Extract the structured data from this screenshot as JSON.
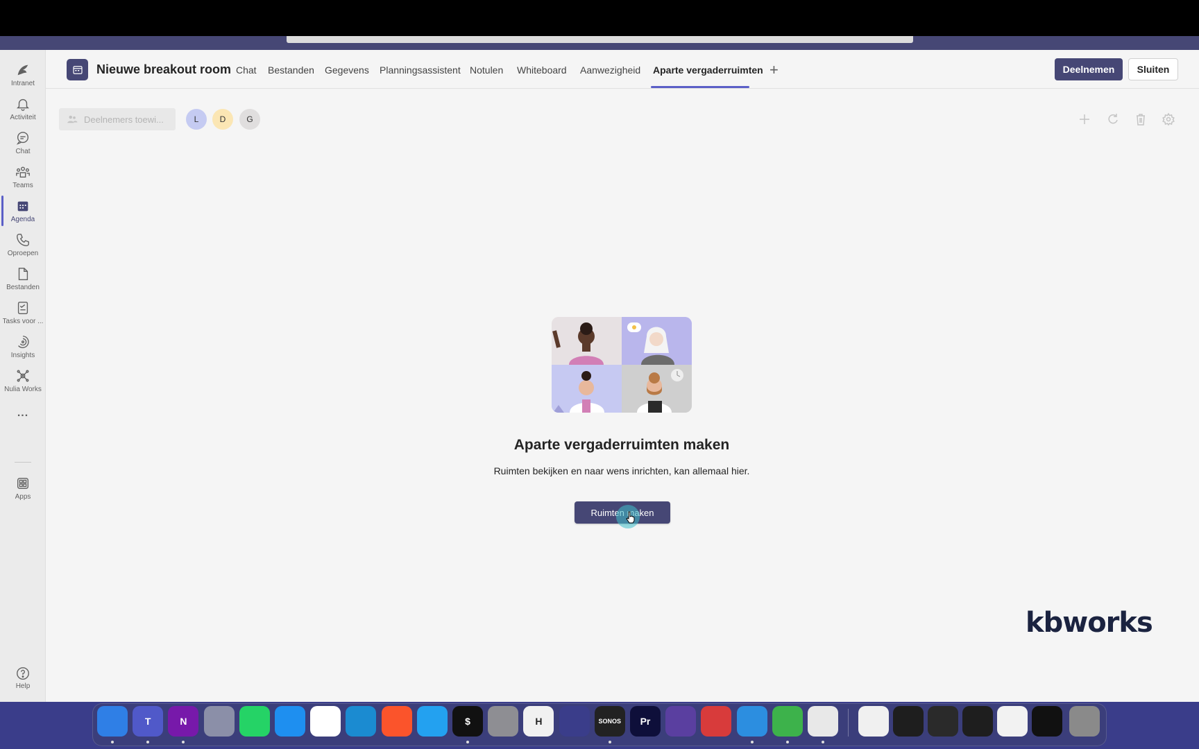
{
  "meeting": {
    "title": "Nieuwe breakout room"
  },
  "tabs": [
    "Chat",
    "Bestanden",
    "Gegevens",
    "Planningsassistent",
    "Notulen",
    "Whiteboard",
    "Aanwezigheid",
    "Aparte vergaderruimten"
  ],
  "active_tab": "Aparte vergaderruimten",
  "header_buttons": {
    "join": "Deelnemen",
    "close": "Sluiten"
  },
  "rail": [
    {
      "label": "Intranet",
      "icon": "intranet-icon"
    },
    {
      "label": "Activiteit",
      "icon": "bell-icon"
    },
    {
      "label": "Chat",
      "icon": "chat-icon"
    },
    {
      "label": "Teams",
      "icon": "teams-icon"
    },
    {
      "label": "Agenda",
      "icon": "calendar-icon",
      "active": true
    },
    {
      "label": "Oproepen",
      "icon": "phone-icon"
    },
    {
      "label": "Bestanden",
      "icon": "file-icon"
    },
    {
      "label": "Tasks voor ...",
      "icon": "tasks-icon"
    },
    {
      "label": "Insights",
      "icon": "insights-icon"
    },
    {
      "label": "Nulia Works",
      "icon": "nulia-icon"
    },
    {
      "label": "...",
      "icon": "more-icon"
    },
    {
      "label": "Apps",
      "icon": "apps-icon"
    }
  ],
  "help_label": "Help",
  "toolbar": {
    "assign_label": "Deelnemers toewi...",
    "participants": [
      {
        "initial": "L",
        "color": "#c5cbf2"
      },
      {
        "initial": "D",
        "color": "#fbe6b4"
      },
      {
        "initial": "G",
        "color": "#e0dede"
      }
    ]
  },
  "empty_state": {
    "title": "Aparte vergaderruimten maken",
    "subtitle": "Ruimten bekijken en naar wens inrichten, kan allemaal hier.",
    "button": "Ruimten maken"
  },
  "brand": "kbworks",
  "dock": [
    {
      "name": "finder",
      "bg": "#2f7fe6",
      "text": ""
    },
    {
      "name": "teams",
      "bg": "#5059c9",
      "text": "T"
    },
    {
      "name": "onenote",
      "bg": "#7719aa",
      "text": "N"
    },
    {
      "name": "launchpad",
      "bg": "#8b8fa8",
      "text": ""
    },
    {
      "name": "whatsapp",
      "bg": "#25d366",
      "text": ""
    },
    {
      "name": "safari",
      "bg": "#1e8ff0",
      "text": ""
    },
    {
      "name": "chrome",
      "bg": "#ffffff",
      "text": ""
    },
    {
      "name": "edge",
      "bg": "#1b8bd1",
      "text": ""
    },
    {
      "name": "brave",
      "bg": "#fb542b",
      "text": ""
    },
    {
      "name": "vscode",
      "bg": "#23a1f0",
      "text": ""
    },
    {
      "name": "terminal",
      "bg": "#111111",
      "text": "$"
    },
    {
      "name": "system-preferences",
      "bg": "#8e8e93",
      "text": ""
    },
    {
      "name": "hemingway",
      "bg": "#f1f1f1",
      "text": "H"
    },
    {
      "name": "todo",
      "bg": "#3a3d8a",
      "text": ""
    },
    {
      "name": "sonos",
      "bg": "#222222",
      "text": "SONOS"
    },
    {
      "name": "premiere",
      "bg": "#0e0f3a",
      "text": "Pr"
    },
    {
      "name": "github",
      "bg": "#5a3fa0",
      "text": ""
    },
    {
      "name": "remote-desktop",
      "bg": "#d83b3b",
      "text": ""
    },
    {
      "name": "windows-app",
      "bg": "#2c8ee0",
      "text": ""
    },
    {
      "name": "numbers",
      "bg": "#3db24b",
      "text": ""
    },
    {
      "name": "parallels",
      "bg": "#e8e8e8",
      "text": ""
    }
  ]
}
